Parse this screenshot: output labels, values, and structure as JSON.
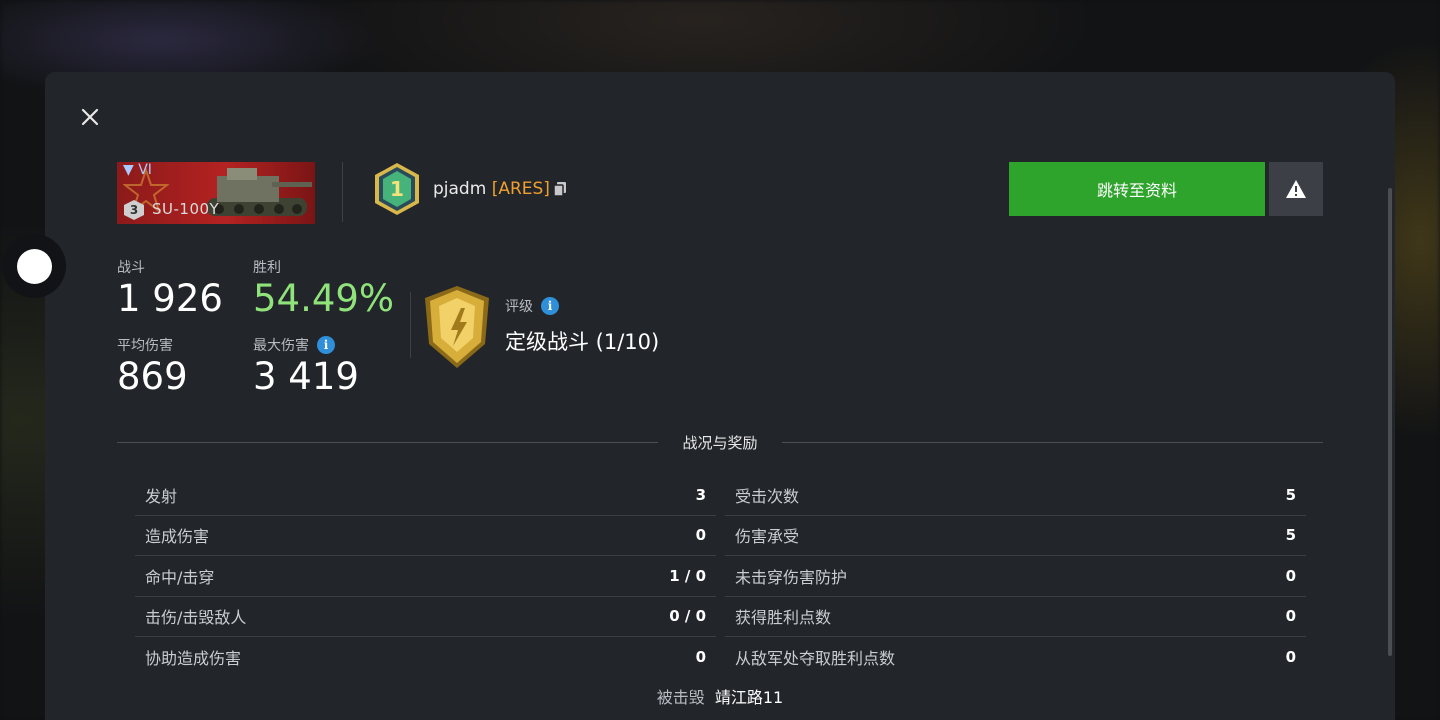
{
  "tank": {
    "tier": "VI",
    "mastery_level": "3",
    "name": "SU-100Y"
  },
  "player": {
    "rank_number": "1",
    "name": "pjadm",
    "clan": "[ARES]"
  },
  "actions": {
    "goto_profile": "跳转至资料"
  },
  "stats": {
    "battles": {
      "label": "战斗",
      "value": "1 926"
    },
    "win_rate": {
      "label": "胜利",
      "value": "54.49%"
    },
    "avg_damage": {
      "label": "平均伤害",
      "value": "869"
    },
    "max_damage": {
      "label": "最大伤害",
      "value": "3 419"
    }
  },
  "rating": {
    "label": "评级",
    "value": "定级战斗 (1/10)"
  },
  "section_title": "战况与奖励",
  "left_rows": [
    {
      "label": "发射",
      "value": "3"
    },
    {
      "label": "造成伤害",
      "value": "0"
    },
    {
      "label": "命中/击穿",
      "value": "1 / 0"
    },
    {
      "label": "击伤/击毁敌人",
      "value": "0 / 0"
    },
    {
      "label": "协助造成伤害",
      "value": "0"
    }
  ],
  "right_rows": [
    {
      "label": "受击次数",
      "value": "5"
    },
    {
      "label": "伤害承受",
      "value": "5"
    },
    {
      "label": "未击穿伤害防护",
      "value": "0"
    },
    {
      "label": "获得胜利点数",
      "value": "0"
    },
    {
      "label": "从敌军处夺取胜利点数",
      "value": "0"
    }
  ],
  "destroyed": {
    "label": "被击毁",
    "by": "靖江路11"
  },
  "colors": {
    "panel": "#22252a",
    "green_button": "#2fa42c",
    "win_rate": "#8fe37a",
    "clan": "#f0a030",
    "info": "#2f8fd8"
  }
}
